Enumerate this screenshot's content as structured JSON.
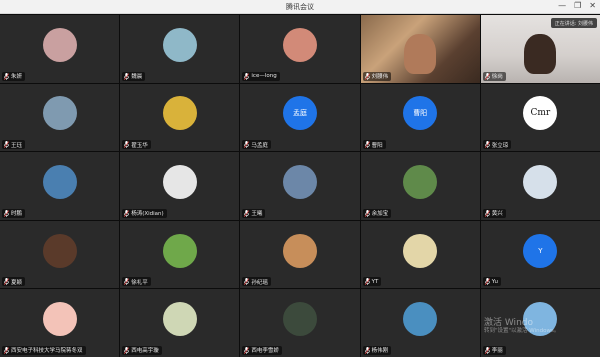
{
  "window": {
    "title": "腾讯会议"
  },
  "speaking": {
    "label": "正在讲话: 刘腰伟"
  },
  "participants": [
    {
      "name": "朱妍",
      "avatar_text": "",
      "avatar_color": "#c9a0a0"
    },
    {
      "name": "魏晨",
      "avatar_text": "",
      "avatar_color": "#8fb8c8"
    },
    {
      "name": "ice—long",
      "avatar_text": "",
      "avatar_color": "#d28a78"
    },
    {
      "name": "刘腰伟",
      "avatar_text": "",
      "avatar_color": "#6b4c3a"
    },
    {
      "name": "徐岗",
      "avatar_text": "",
      "avatar_color": "#cfc9c7"
    },
    {
      "name": "王珏",
      "avatar_text": "",
      "avatar_color": "#7f9ab0"
    },
    {
      "name": "翟玉华",
      "avatar_text": "",
      "avatar_color": "#d9b23a"
    },
    {
      "name": "马孟庭",
      "avatar_text": "孟庭",
      "avatar_color": "#1f74e8"
    },
    {
      "name": "曹阳",
      "avatar_text": "曹阳",
      "avatar_color": "#1f74e8"
    },
    {
      "name": "张立琼",
      "avatar_text": "Cmr",
      "avatar_color": "#ffffff"
    },
    {
      "name": "时鹏",
      "avatar_text": "",
      "avatar_color": "#4a7fb0"
    },
    {
      "name": "杨涛(Xidian)",
      "avatar_text": "",
      "avatar_color": "#e6e6e6"
    },
    {
      "name": "王曦",
      "avatar_text": "",
      "avatar_color": "#6c87a8"
    },
    {
      "name": "余加宝",
      "avatar_text": "",
      "avatar_color": "#5f8a4a"
    },
    {
      "name": "黄兴",
      "avatar_text": "",
      "avatar_color": "#d6e0ea"
    },
    {
      "name": "夏颖",
      "avatar_text": "",
      "avatar_color": "#5a3a2a"
    },
    {
      "name": "徐礼平",
      "avatar_text": "",
      "avatar_color": "#6fa84a"
    },
    {
      "name": "孙纪瑶",
      "avatar_text": "",
      "avatar_color": "#c78e5a"
    },
    {
      "name": "YT",
      "avatar_text": "",
      "avatar_color": "#e3d6a8"
    },
    {
      "name": "Yu",
      "avatar_text": "Y",
      "avatar_color": "#1f74e8"
    },
    {
      "name": "西安电子科技大学马院蒋冬双",
      "avatar_text": "",
      "avatar_color": "#f3c3b8"
    },
    {
      "name": "西电高宇璇",
      "avatar_text": "",
      "avatar_color": "#cfd7b5"
    },
    {
      "name": "西电李雪娇",
      "avatar_text": "",
      "avatar_color": "#3c4a3c"
    },
    {
      "name": "杨伟刚",
      "avatar_text": "",
      "avatar_color": "#4a8fc0"
    },
    {
      "name": "李丽",
      "avatar_text": "",
      "avatar_color": "#7fb5e0"
    }
  ],
  "watermark": {
    "line1": "激活 Windo",
    "line2": "转到\"设置\"以激活 Windows。"
  }
}
